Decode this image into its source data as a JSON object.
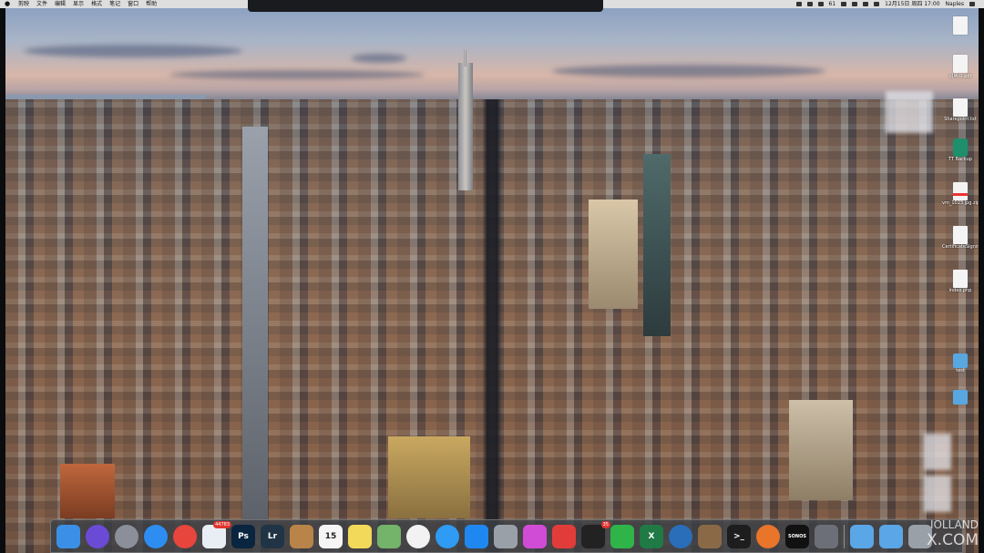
{
  "menubar": {
    "items": [
      "剪映",
      "文件",
      "编辑",
      "显示",
      "格式",
      "笔记",
      "窗口",
      "帮助"
    ],
    "status": {
      "badge_count": "61",
      "date_time": "12月15日 周四 17:00",
      "user": "Naples"
    }
  },
  "desktop_icons": [
    {
      "label": "",
      "kind": "doc"
    },
    {
      "label": "说明书.pdf",
      "kind": "doc"
    },
    {
      "label": "Sharepoint.txt",
      "kind": "doc"
    },
    {
      "label": "TT Backup",
      "kind": "green"
    },
    {
      "label": "vm_1023.jpg.zip",
      "kind": "pdf"
    },
    {
      "label": "CertificateSigningRequest...Request",
      "kind": "doc"
    },
    {
      "label": "index.php",
      "kind": "doc"
    },
    {
      "label": "test",
      "kind": "blue"
    },
    {
      "label": "",
      "kind": "blue"
    }
  ],
  "dock": {
    "items": [
      {
        "name": "finder",
        "text": "",
        "color": "#3b8fe6"
      },
      {
        "name": "siri",
        "text": "",
        "color": "#6b4bd6"
      },
      {
        "name": "launchpad",
        "text": "",
        "color": "#8a8f99"
      },
      {
        "name": "safari",
        "text": "",
        "color": "#2d8df0"
      },
      {
        "name": "chrome",
        "text": "",
        "color": "#e8453c"
      },
      {
        "name": "mail",
        "text": "",
        "color": "#e9eef5",
        "badge": "44783"
      },
      {
        "name": "photoshop",
        "text": "Ps",
        "color": "#0a2540"
      },
      {
        "name": "lightroom",
        "text": "Lr",
        "color": "#203445"
      },
      {
        "name": "notebook",
        "text": "",
        "color": "#b8844a"
      },
      {
        "name": "calendar",
        "text": "15",
        "color": "#f5f5f5"
      },
      {
        "name": "notes",
        "text": "",
        "color": "#f3d95a"
      },
      {
        "name": "maps",
        "text": "",
        "color": "#74b36a"
      },
      {
        "name": "photos",
        "text": "",
        "color": "#f2f2f2"
      },
      {
        "name": "messages",
        "text": "",
        "color": "#2f9bf2"
      },
      {
        "name": "app-store",
        "text": "",
        "color": "#1e88f0"
      },
      {
        "name": "system-preferences",
        "text": "",
        "color": "#9aa0a8"
      },
      {
        "name": "petal",
        "text": "",
        "color": "#d14cd6"
      },
      {
        "name": "netease",
        "text": "",
        "color": "#e23c3a"
      },
      {
        "name": "qq",
        "text": "",
        "color": "#222",
        "badge": "35"
      },
      {
        "name": "wechat",
        "text": "",
        "color": "#2fb44a"
      },
      {
        "name": "excel",
        "text": "X",
        "color": "#1f7a45"
      },
      {
        "name": "quicktime",
        "text": "",
        "color": "#2a6db8"
      },
      {
        "name": "preview",
        "text": "",
        "color": "#8a6a46"
      },
      {
        "name": "terminal",
        "text": ">_",
        "color": "#1d1d1d"
      },
      {
        "name": "firefox",
        "text": "",
        "color": "#e8752a"
      },
      {
        "name": "sonos",
        "text": "SONOS",
        "color": "#111"
      },
      {
        "name": "automator",
        "text": "",
        "color": "#6c6f78"
      },
      {
        "name": "folder-downloads",
        "text": "",
        "color": "#5aa6e6"
      },
      {
        "name": "folder-apps",
        "text": "",
        "color": "#5aa6e6"
      },
      {
        "name": "trash",
        "text": "",
        "color": "#9aa0a8"
      }
    ]
  },
  "watermark": {
    "line1": "IOLLAND",
    "line2": "X.COM"
  }
}
